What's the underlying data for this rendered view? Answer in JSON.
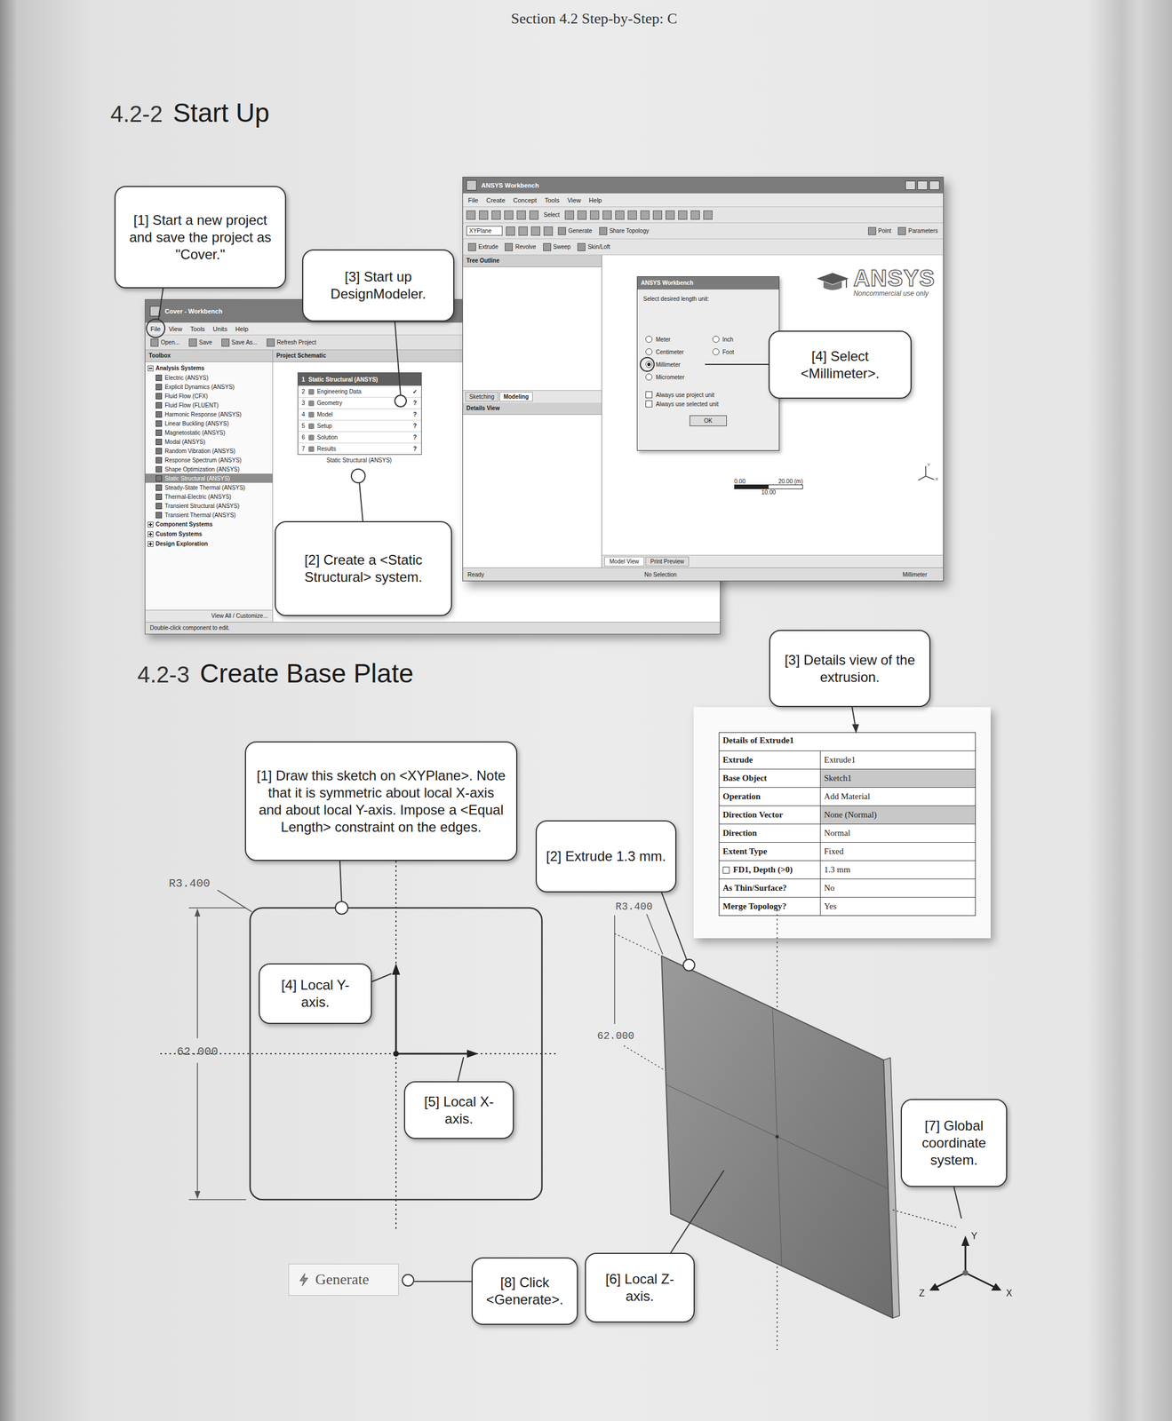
{
  "running_head": "Section 4.2  Step-by-Step: C",
  "sections": [
    {
      "number": "4.2-2",
      "title": "Start Up"
    },
    {
      "number": "4.2-3",
      "title": "Create Base Plate"
    }
  ],
  "startup": {
    "callouts": [
      "[1] Start a new project and save the project as \"Cover.\"",
      "[2] Create a <Static Structural> system.",
      "[3] Start up DesignModeler.",
      "[4] Select <Millimeter>."
    ],
    "workbench": {
      "title": "Cover - Workbench",
      "menu": [
        "File",
        "View",
        "Tools",
        "Units",
        "Help"
      ],
      "toolbar": [
        "Open...",
        "Save",
        "Save As...",
        "Refresh Project"
      ],
      "toolbox_title": "Toolbox",
      "groups": [
        {
          "label": "Analysis Systems",
          "expanded": true,
          "items": [
            {
              "label": "Electric (ANSYS)",
              "selected": false
            },
            {
              "label": "Explicit Dynamics (ANSYS)",
              "selected": false
            },
            {
              "label": "Fluid Flow (CFX)",
              "selected": false
            },
            {
              "label": "Fluid Flow (FLUENT)",
              "selected": false
            },
            {
              "label": "Harmonic Response (ANSYS)",
              "selected": false
            },
            {
              "label": "Linear Buckling (ANSYS)",
              "selected": false
            },
            {
              "label": "Magnetostatic (ANSYS)",
              "selected": false
            },
            {
              "label": "Modal (ANSYS)",
              "selected": false
            },
            {
              "label": "Random Vibration (ANSYS)",
              "selected": false
            },
            {
              "label": "Response Spectrum (ANSYS)",
              "selected": false
            },
            {
              "label": "Shape Optimization (ANSYS)",
              "selected": false
            },
            {
              "label": "Static Structural (ANSYS)",
              "selected": true
            },
            {
              "label": "Steady-State Thermal (ANSYS)",
              "selected": false
            },
            {
              "label": "Thermal-Electric (ANSYS)",
              "selected": false
            },
            {
              "label": "Transient Structural (ANSYS)",
              "selected": false
            },
            {
              "label": "Transient Thermal (ANSYS)",
              "selected": false
            }
          ]
        },
        {
          "label": "Component Systems",
          "expanded": false,
          "items": []
        },
        {
          "label": "Custom Systems",
          "expanded": false,
          "items": []
        },
        {
          "label": "Design Exploration",
          "expanded": false,
          "items": []
        }
      ],
      "view_all": "View All / Customize...",
      "schematic_title": "Project Schematic",
      "system": {
        "number": "1",
        "title": "Static Structural (ANSYS)",
        "cells": [
          {
            "number": "2",
            "label": "Engineering Data",
            "status": "✓"
          },
          {
            "number": "3",
            "label": "Geometry",
            "status": "?"
          },
          {
            "number": "4",
            "label": "Model",
            "status": "?"
          },
          {
            "number": "5",
            "label": "Setup",
            "status": "?"
          },
          {
            "number": "6",
            "label": "Solution",
            "status": "?"
          },
          {
            "number": "7",
            "label": "Results",
            "status": "?"
          }
        ],
        "caption": "Static Structural (ANSYS)"
      },
      "status": "Double-click component to edit."
    },
    "design_modeler": {
      "title": "ANSYS Workbench",
      "menu": [
        "File",
        "Create",
        "Concept",
        "Tools",
        "View",
        "Help"
      ],
      "select": "Select",
      "plane": "XYPlane",
      "tools": [
        "Generate",
        "Share Topology"
      ],
      "right_tools": [
        "Point",
        "Parameters"
      ],
      "features": [
        "Extrude",
        "Revolve",
        "Sweep",
        "Skin/Loft"
      ],
      "tree_title": "Tree Outline",
      "panel_tabs": [
        {
          "label": "Sketching",
          "selected": false
        },
        {
          "label": "Modeling",
          "selected": true
        }
      ],
      "details_title": "Details View",
      "logo": {
        "brand": "ANSYS",
        "note": "Noncommercial use only"
      },
      "dialog": {
        "title": "ANSYS Workbench",
        "prompt": "Select desired length unit:",
        "units": [
          {
            "label": "Meter",
            "selected": false
          },
          {
            "label": "Centimeter",
            "selected": false
          },
          {
            "label": "Millimeter",
            "selected": true
          },
          {
            "label": "Micrometer",
            "selected": false
          },
          {
            "label": "Inch",
            "selected": false
          },
          {
            "label": "Foot",
            "selected": false
          }
        ],
        "options": [
          {
            "label": "Always use project unit",
            "checked": false
          },
          {
            "label": "Always use selected unit",
            "checked": false
          }
        ],
        "button": "OK"
      },
      "scale": {
        "start": "0.00",
        "end": "20.00 (m)",
        "mid": "10.00"
      },
      "triad": [
        "Y",
        "X"
      ],
      "view_tabs": [
        {
          "label": "Model View",
          "selected": true
        },
        {
          "label": "Print Preview",
          "selected": false
        }
      ],
      "status": {
        "left": "Ready",
        "middle": "No Selection",
        "right": "Millimeter"
      }
    }
  },
  "base_plate": {
    "callouts": {
      "sketch": "[1] Draw this sketch on <XYPlane>. Note that it is symmetric about local X-axis and about local Y-axis. Impose a <Equal Length> constraint on the edges.",
      "extrude": "[2] Extrude 1.3 mm.",
      "details": "[3] Details view of the extrusion.",
      "local_y": "[4] Local Y-axis.",
      "local_x": "[5] Local X-axis.",
      "local_z": "[6] Local Z-axis.",
      "global": "[7] Global coordinate system.",
      "generate": "[8] Click <Generate>."
    },
    "sketch": {
      "radius": "R3.400",
      "size": "62.000"
    },
    "model": {
      "radius": "R3.400",
      "size": "62.000"
    },
    "details": {
      "title": "Details of Extrude1",
      "rows": [
        {
          "label": "Extrude",
          "value": "Extrude1",
          "highlighted": false,
          "kind": "plain"
        },
        {
          "label": "Base Object",
          "value": "Sketch1",
          "highlighted": true,
          "kind": "plain"
        },
        {
          "label": "Operation",
          "value": "Add Material",
          "highlighted": false,
          "kind": "plain"
        },
        {
          "label": "Direction Vector",
          "value": "None (Normal)",
          "highlighted": true,
          "kind": "plain"
        },
        {
          "label": "Direction",
          "value": "Normal",
          "highlighted": false,
          "kind": "plain"
        },
        {
          "label": "Extent Type",
          "value": "Fixed",
          "highlighted": false,
          "kind": "plain"
        },
        {
          "label": "FD1, Depth (>0)",
          "value": "1.3 mm",
          "highlighted": false,
          "kind": "parameter",
          "checked": false
        },
        {
          "label": "As Thin/Surface?",
          "value": "No",
          "highlighted": false,
          "kind": "plain"
        },
        {
          "label": "Merge Topology?",
          "value": "Yes",
          "highlighted": false,
          "kind": "plain"
        }
      ]
    },
    "axes": [
      "Y",
      "Z",
      "X"
    ],
    "generate_button": "Generate"
  }
}
